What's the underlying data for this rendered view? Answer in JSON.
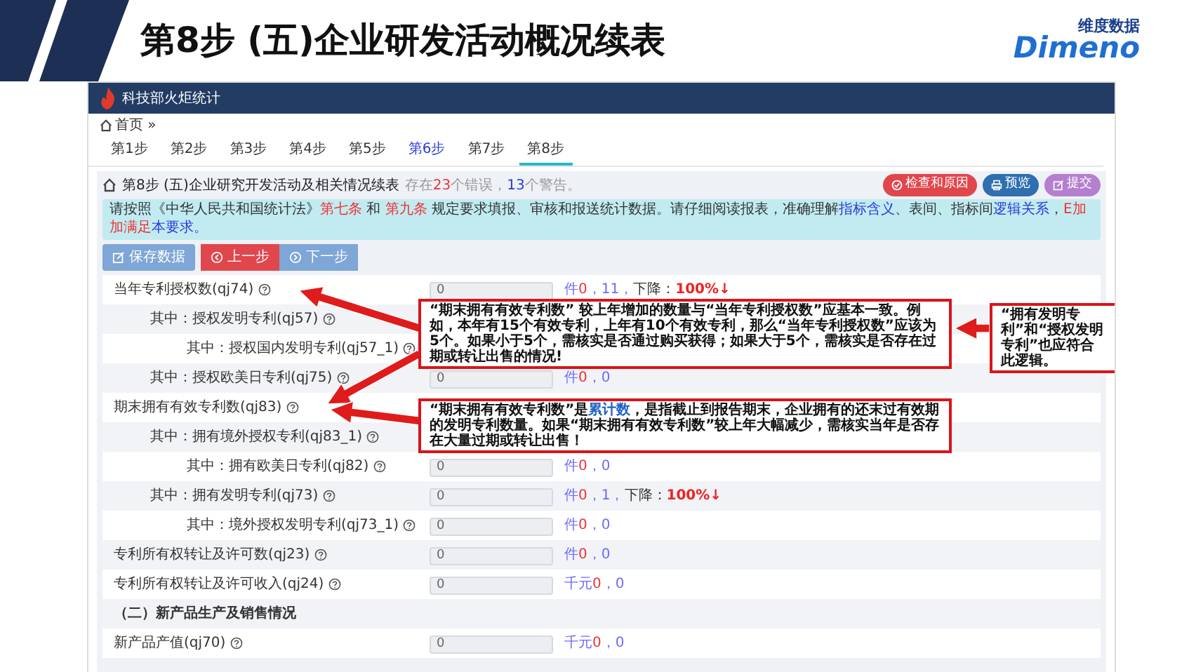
{
  "slide": {
    "title": "第8步  (五)企业研发活动概况续表",
    "logo_cn": "维度数据",
    "logo_en": "Dimeno"
  },
  "app": {
    "title": "科技部火炬统计"
  },
  "breadcrumb": "首页 »",
  "steps": [
    {
      "label": "第1步",
      "selected": false,
      "highlighted": false
    },
    {
      "label": "第2步",
      "selected": false,
      "highlighted": false
    },
    {
      "label": "第3步",
      "selected": false,
      "highlighted": false
    },
    {
      "label": "第4步",
      "selected": false,
      "highlighted": false
    },
    {
      "label": "第5步",
      "selected": false,
      "highlighted": false
    },
    {
      "label": "第6步",
      "selected": false,
      "highlighted": true
    },
    {
      "label": "第7步",
      "selected": false,
      "highlighted": false
    },
    {
      "label": "第8步",
      "selected": true,
      "highlighted": false
    }
  ],
  "panel": {
    "title": "第8步 (五)企业研究开发活动及相关情况续表",
    "status": [
      {
        "text": "存在",
        "kind": "plain"
      },
      {
        "text": "23",
        "kind": "error"
      },
      {
        "text": "个错误，",
        "kind": "plain"
      },
      {
        "text": "13",
        "kind": "link"
      },
      {
        "text": "个警告。",
        "kind": "plain"
      }
    ]
  },
  "actions": [
    {
      "label": "检查和原因",
      "kind": "danger"
    },
    {
      "label": "预览",
      "kind": "primary"
    },
    {
      "label": "提交",
      "kind": "purple"
    }
  ],
  "notice": [
    {
      "text": "请按照《中华人民共和国统计法》",
      "kind": "plain"
    },
    {
      "text": "第七条",
      "kind": "error"
    },
    {
      "text": " 和 ",
      "kind": "plain"
    },
    {
      "text": "第九条",
      "kind": "error"
    },
    {
      "text": " 规定要求填报、审核和报送统计数据。请仔细阅读报表，准确理解",
      "kind": "plain"
    },
    {
      "text": "指标含义",
      "kind": "link"
    },
    {
      "text": "、表间、指标间",
      "kind": "plain"
    },
    {
      "text": "逻辑关系",
      "kind": "link"
    },
    {
      "text": "，",
      "kind": "plain"
    },
    {
      "text": "E加加满足",
      "kind": "error"
    },
    {
      "text": "本要求。",
      "kind": "link"
    }
  ],
  "form_buttons": [
    {
      "label": "保存数据",
      "kind": "save"
    },
    {
      "label": "上一步",
      "kind": "prev"
    },
    {
      "label": "下一步",
      "kind": "next"
    }
  ],
  "rows": [
    {
      "kind": "field",
      "label": "当年专利授权数(qj74)",
      "value": "0",
      "note": [
        {
          "text": "件",
          "kind": "unit"
        },
        {
          "text": "0",
          "kind": "current"
        },
        {
          "text": "，11，",
          "kind": "unit"
        },
        {
          "text": "下降：",
          "kind": "label"
        },
        {
          "text": "100%↓",
          "kind": "alert"
        }
      ],
      "children": [
        {
          "kind": "field",
          "label": "其中：授权发明专利(qj57)",
          "children": [
            {
              "kind": "field",
              "label": "其中：授权国内发明专利(qj57_1)"
            }
          ]
        },
        {
          "kind": "field",
          "label": "其中：授权欧美日专利(qj75)",
          "value": "0",
          "note": [
            {
              "text": "件",
              "kind": "unit"
            },
            {
              "text": "0",
              "kind": "current"
            },
            {
              "text": "，0",
              "kind": "unit"
            }
          ]
        }
      ]
    },
    {
      "kind": "field",
      "label": "期末拥有有效专利数(qj83)",
      "children": [
        {
          "kind": "field",
          "label": "其中：拥有境外授权专利(qj83_1)",
          "children": [
            {
              "kind": "field",
              "label": "其中：拥有欧美日专利(qj82)",
              "value": "0",
              "note": [
                {
                  "text": "件",
                  "kind": "unit"
                },
                {
                  "text": "0",
                  "kind": "current"
                },
                {
                  "text": "，0",
                  "kind": "unit"
                }
              ]
            }
          ]
        },
        {
          "kind": "field",
          "label": "其中：拥有发明专利(qj73)",
          "value": "0",
          "note": [
            {
              "text": "件",
              "kind": "unit"
            },
            {
              "text": "0",
              "kind": "current"
            },
            {
              "text": "，1，",
              "kind": "unit"
            },
            {
              "text": "下降：",
              "kind": "label"
            },
            {
              "text": "100%↓",
              "kind": "alert"
            }
          ],
          "children": [
            {
              "kind": "field",
              "label": "其中：境外授权发明专利(qj73_1)",
              "value": "0",
              "note": [
                {
                  "text": "件",
                  "kind": "unit"
                },
                {
                  "text": "0",
                  "kind": "current"
                },
                {
                  "text": "，0",
                  "kind": "unit"
                }
              ]
            }
          ]
        }
      ]
    },
    {
      "kind": "field",
      "label": "专利所有权转让及许可数(qj23)",
      "value": "0",
      "note": [
        {
          "text": "件",
          "kind": "unit"
        },
        {
          "text": "0",
          "kind": "current"
        },
        {
          "text": "，0",
          "kind": "unit"
        }
      ]
    },
    {
      "kind": "field",
      "label": "专利所有权转让及许可收入(qj24)",
      "value": "0",
      "note": [
        {
          "text": "千元",
          "kind": "unit"
        },
        {
          "text": "0",
          "kind": "current"
        },
        {
          "text": "，0",
          "kind": "unit"
        }
      ]
    },
    {
      "kind": "section",
      "label": "（二）新产品生产及销售情况"
    },
    {
      "kind": "field",
      "label": "新产品产值(qj70)",
      "value": "0",
      "note": [
        {
          "text": "千元",
          "kind": "unit"
        },
        {
          "text": "0",
          "kind": "current"
        },
        {
          "text": "，0",
          "kind": "unit"
        }
      ]
    }
  ],
  "callouts": [
    {
      "parts": [
        {
          "text": "“期末拥有有效专利数” 较上年增加的数量与“当年专利授权数”应基本一致。例如，本年有15个有效专利，上年有10个有效专利，那么“当年专利授权数”应该为5个。如果小于5个，需核实是否通过购买获得；如果大于5个，需核实是否存在过期或转让出售的情况!",
          "kind": "plain"
        }
      ]
    },
    {
      "parts": [
        {
          "text": "“期末拥有有效专利数”是",
          "kind": "plain"
        },
        {
          "text": "累计数",
          "kind": "link"
        },
        {
          "text": "，是指截止到报告期末，企业拥有的还末过有效期的发明专利数量。如果“期末拥有有效专利数”较上年大幅减少，需核实当年是否存在大量过期或转让出售！",
          "kind": "plain"
        }
      ]
    },
    {
      "parts": [
        {
          "text": "“拥有发明专利”和“授权发明专利”也应符合此逻辑。",
          "kind": "plain"
        }
      ]
    }
  ]
}
